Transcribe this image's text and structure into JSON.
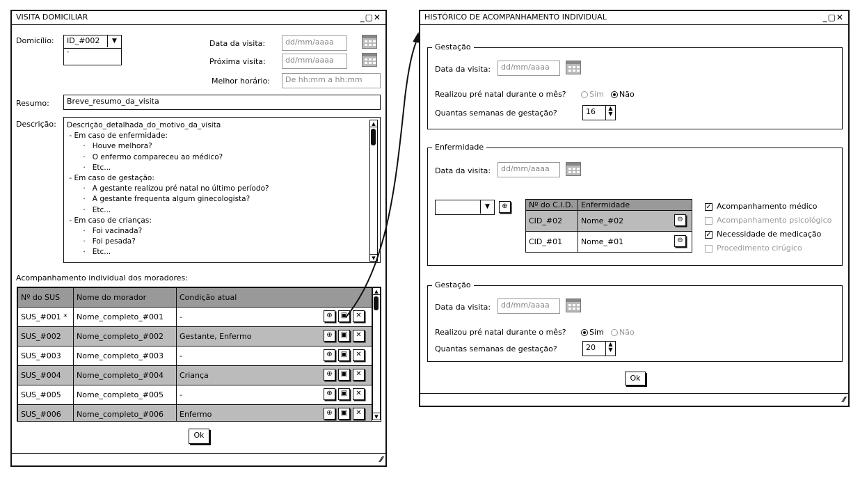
{
  "visita": {
    "title": "VISITA DOMICILIAR",
    "window_controls": "_▢✕",
    "domicilio_label": "Domicílio:",
    "domicilio_value": "ID_#002",
    "domicilio_sub": "-",
    "data_visita_label": "Data da visita:",
    "data_visita_placeholder": "dd/mm/aaaa",
    "proxima_visita_label": "Próxima visita:",
    "proxima_visita_placeholder": "dd/mm/aaaa",
    "melhor_horario_label": "Melhor horário:",
    "melhor_horario_placeholder": "De hh:mm a hh:mm",
    "resumo_label": "Resumo:",
    "resumo_value": "Breve_resumo_da_visita",
    "descricao_label": "Descrição:",
    "descricao_lines": [
      "Descrição_detalhada_do_motivo_da_visita",
      " - Em caso de enfermidade:",
      "       ·   Houve melhora?",
      "       ·   O enfermo compareceu ao médico?",
      "       ·   Etc...",
      " - Em caso de gestação:",
      "       ·   A gestante realizou pré natal no último período?",
      "       ·   A gestante frequenta algum ginecologista?",
      "       ·   Etc...",
      " - Em caso de crianças:",
      "       ·   Foi vacinada?",
      "       ·   Foi pesada?",
      "       ·   Etc..."
    ],
    "acompanhamento_label": "Acompanhamento individual dos moradores:",
    "table_headers": [
      "Nº do SUS",
      "Nome do morador",
      "Condição atual"
    ],
    "rows": [
      {
        "sus": "SUS_#001 *",
        "nome": "Nome_completo_#001",
        "cond": "-"
      },
      {
        "sus": "SUS_#002",
        "nome": "Nome_completo_#002",
        "cond": "Gestante, Enfermo"
      },
      {
        "sus": "SUS_#003",
        "nome": "Nome_completo_#003",
        "cond": "-"
      },
      {
        "sus": "SUS_#004",
        "nome": "Nome_completo_#004",
        "cond": "Criança"
      },
      {
        "sus": "SUS_#005",
        "nome": "Nome_completo_#005",
        "cond": "-"
      },
      {
        "sus": "SUS_#006",
        "nome": "Nome_completo_#006",
        "cond": "Enfermo"
      }
    ],
    "ok_label": "Ok"
  },
  "historico": {
    "title": "HISTÓRICO DE ACOMPANHAMENTO INDIVIDUAL",
    "window_controls": "_▢✕",
    "gestacao1": {
      "legend": "Gestação",
      "data_label": "Data da visita:",
      "data_placeholder": "dd/mm/aaaa",
      "prenatal_label": "Realizou pré natal durante o mês?",
      "sim_label": "Sim",
      "nao_label": "Não",
      "prenatal_value": "Não",
      "semanas_label": "Quantas semanas de gestação?",
      "semanas_value": "16"
    },
    "enfermidade": {
      "legend": "Enfermidade",
      "data_label": "Data da visita:",
      "data_placeholder": "dd/mm/aaaa",
      "table_headers": [
        "Nº do C.I.D.",
        "Enfermidade"
      ],
      "rows": [
        {
          "cid": "CID_#02",
          "nome": "Nome_#02"
        },
        {
          "cid": "CID_#01",
          "nome": "Nome_#01"
        }
      ],
      "checks": [
        {
          "label": "Acompanhamento médico",
          "checked": true,
          "enabled": true
        },
        {
          "label": "Acompanhamento psicológico",
          "checked": false,
          "enabled": false
        },
        {
          "label": "Necessidade de medicação",
          "checked": true,
          "enabled": true
        },
        {
          "label": "Procedimento cirúgico",
          "checked": false,
          "enabled": false
        }
      ]
    },
    "gestacao2": {
      "legend": "Gestação",
      "data_label": "Data da visita:",
      "data_placeholder": "dd/mm/aaaa",
      "prenatal_label": "Realizou pré natal durante o mês?",
      "sim_label": "Sim",
      "nao_label": "Não",
      "prenatal_value": "Sim",
      "semanas_label": "Quantas semanas de gestação?",
      "semanas_value": "20"
    },
    "ok_label": "Ok"
  }
}
